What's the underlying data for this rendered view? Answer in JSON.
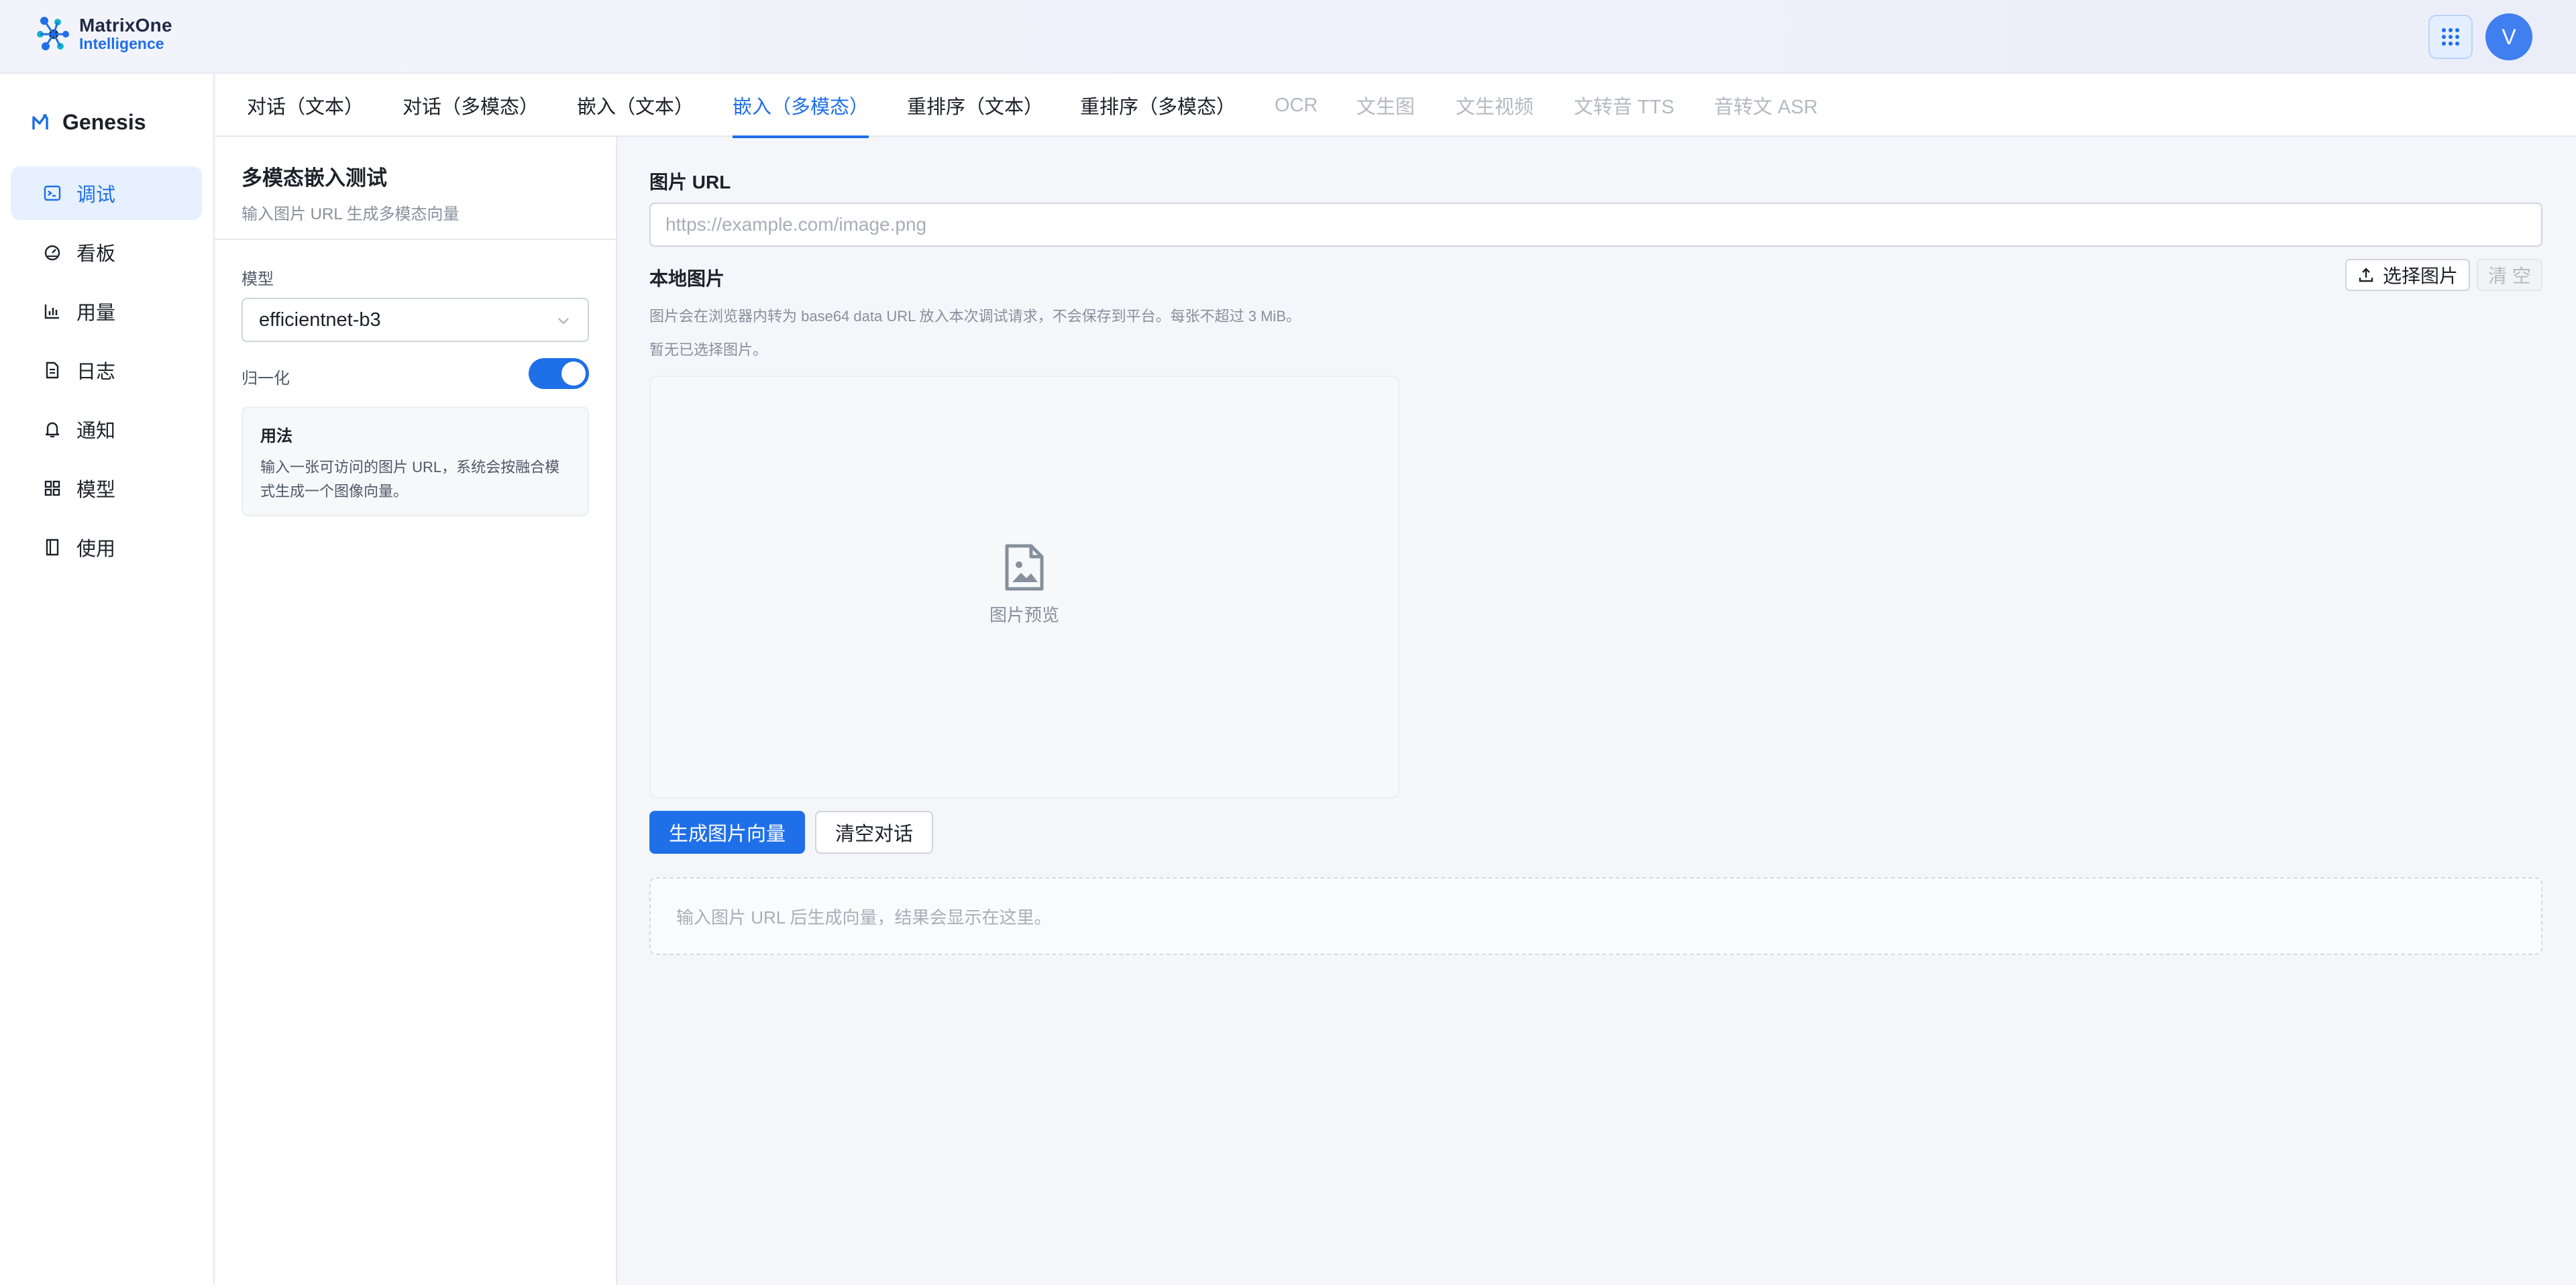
{
  "app": {
    "logo_line1": "MatrixOne",
    "logo_line2": "Intelligence",
    "avatar_letter": "V",
    "accent_color": "#1f6fe8"
  },
  "sidebar": {
    "brand": "Genesis",
    "items": [
      {
        "label": "调试",
        "icon": "terminal-icon",
        "active": true
      },
      {
        "label": "看板",
        "icon": "dashboard-gauge-icon",
        "active": false
      },
      {
        "label": "用量",
        "icon": "bar-chart-icon",
        "active": false
      },
      {
        "label": "日志",
        "icon": "document-icon",
        "active": false
      },
      {
        "label": "通知",
        "icon": "bell-icon",
        "active": false
      },
      {
        "label": "模型",
        "icon": "grid-icon",
        "active": false
      },
      {
        "label": "使用",
        "icon": "book-icon",
        "active": false
      }
    ]
  },
  "tabs": [
    {
      "label": "对话（文本）",
      "state": "normal"
    },
    {
      "label": "对话（多模态）",
      "state": "normal"
    },
    {
      "label": "嵌入（文本）",
      "state": "normal"
    },
    {
      "label": "嵌入（多模态）",
      "state": "active"
    },
    {
      "label": "重排序（文本）",
      "state": "normal"
    },
    {
      "label": "重排序（多模态）",
      "state": "normal"
    },
    {
      "label": "OCR",
      "state": "disabled"
    },
    {
      "label": "文生图",
      "state": "disabled"
    },
    {
      "label": "文生视频",
      "state": "disabled"
    },
    {
      "label": "文转音 TTS",
      "state": "disabled"
    },
    {
      "label": "音转文 ASR",
      "state": "disabled"
    }
  ],
  "config": {
    "title": "多模态嵌入测试",
    "subtitle": "输入图片 URL 生成多模态向量",
    "model_label": "模型",
    "model_value": "efficientnet-b3",
    "normalize_label": "归一化",
    "normalize_on": true,
    "usage_title": "用法",
    "usage_line1": "输入一张可访问的图片 URL，系统会按融合模",
    "usage_line2": "式生成一个图像向量。"
  },
  "main": {
    "url_label": "图片 URL",
    "url_placeholder": "https://example.com/image.png",
    "url_value": "",
    "local_label": "本地图片",
    "select_button": "选择图片",
    "clear_button": "清 空",
    "hint": "图片会在浏览器内转为 base64 data URL 放入本次调试请求，不会保存到平台。每张不超过 3 MiB。",
    "no_image": "暂无已选择图片。",
    "preview_label": "图片预览",
    "generate_button": "生成图片向量",
    "clear_chat_button": "清空对话",
    "result_placeholder": "输入图片 URL 后生成向量，结果会显示在这里。"
  }
}
